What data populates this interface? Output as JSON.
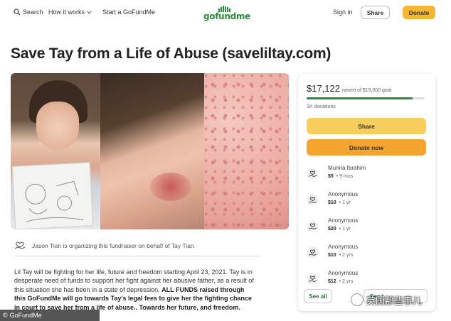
{
  "nav": {
    "search_label": "Search",
    "how_it_works_label": "How it works",
    "start_label": "Start a GoFundMe",
    "logo_text": "gofundme",
    "signin_label": "Sign in",
    "share_label": "Share",
    "donate_label": "Donate"
  },
  "campaign": {
    "title": "Save Tay from a Life of Abuse (saveliltay.com)",
    "organizer_text": "Jason Tian is organizing this fundraiser on behalf of Tay Tian.",
    "story_plain": "Lil Tay will be fighting for her life, future and freedom starting April 23, 2021. Tay is in desperate need of funds to support her fight against her abusive father, as a result of this situation she has been in a state of depression. ",
    "story_bold": "ALL FUNDS raised through this GoFundMe will go towards Tay's legal fees to give her the fighting chance in court to save her from a life of abuse.. Towards her future, and freedom."
  },
  "sidebar": {
    "raised_amount": "$17,122",
    "raised_goal_text": "raised of $19,000 goal",
    "progress_fraction": 0.9,
    "donation_count": "1K donations",
    "share_label": "Share",
    "donate_now_label": "Donate now",
    "donors": [
      {
        "name": "Munira Ibrahim",
        "amount": "$5",
        "time": "9 mos"
      },
      {
        "name": "Anonymous",
        "amount": "$10",
        "time": "1 yr"
      },
      {
        "name": "Anonymous",
        "amount": "$20",
        "time": "1 yr"
      },
      {
        "name": "Anonymous",
        "amount": "$10",
        "time": "2 yrs"
      },
      {
        "name": "Anonymous",
        "amount": "$12",
        "time": "2 yrs"
      }
    ],
    "see_all_label": "See all",
    "see_top_label": "See t"
  },
  "overlays": {
    "credit": "GoFundMe",
    "watermark": "英国那些事儿"
  },
  "colors": {
    "brand_green": "#2a8a3e",
    "donate_orange": "#f4a530",
    "share_yellow": "#f7cd5c"
  }
}
